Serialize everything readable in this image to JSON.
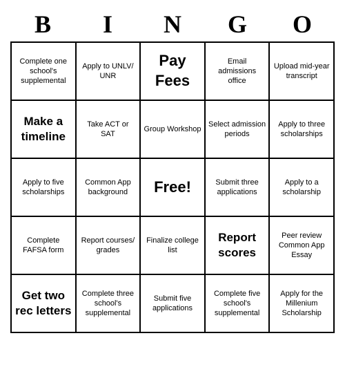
{
  "header": {
    "letters": [
      "B",
      "I",
      "N",
      "G",
      "O"
    ]
  },
  "cells": [
    {
      "text": "Complete one school's supplemental",
      "size": "small"
    },
    {
      "text": "Apply to UNLV/ UNR",
      "size": "small"
    },
    {
      "text": "Pay Fees",
      "size": "large"
    },
    {
      "text": "Email admissions office",
      "size": "small"
    },
    {
      "text": "Upload mid-year transcript",
      "size": "small"
    },
    {
      "text": "Make a timeline",
      "size": "medium"
    },
    {
      "text": "Take ACT or SAT",
      "size": "small"
    },
    {
      "text": "Group Workshop",
      "size": "small"
    },
    {
      "text": "Select admission periods",
      "size": "small"
    },
    {
      "text": "Apply to three scholarships",
      "size": "small"
    },
    {
      "text": "Apply to five scholarships",
      "size": "small"
    },
    {
      "text": "Common App background",
      "size": "small"
    },
    {
      "text": "Free!",
      "size": "large"
    },
    {
      "text": "Submit three applications",
      "size": "small"
    },
    {
      "text": "Apply to a scholarship",
      "size": "small"
    },
    {
      "text": "Complete FAFSA form",
      "size": "small"
    },
    {
      "text": "Report courses/ grades",
      "size": "small"
    },
    {
      "text": "Finalize college list",
      "size": "small"
    },
    {
      "text": "Report scores",
      "size": "medium"
    },
    {
      "text": "Peer review Common App Essay",
      "size": "small"
    },
    {
      "text": "Get two rec letters",
      "size": "medium"
    },
    {
      "text": "Complete three school's supplemental",
      "size": "small"
    },
    {
      "text": "Submit five applications",
      "size": "small"
    },
    {
      "text": "Complete five school's supplemental",
      "size": "small"
    },
    {
      "text": "Apply for the Millenium Scholarship",
      "size": "small"
    }
  ]
}
